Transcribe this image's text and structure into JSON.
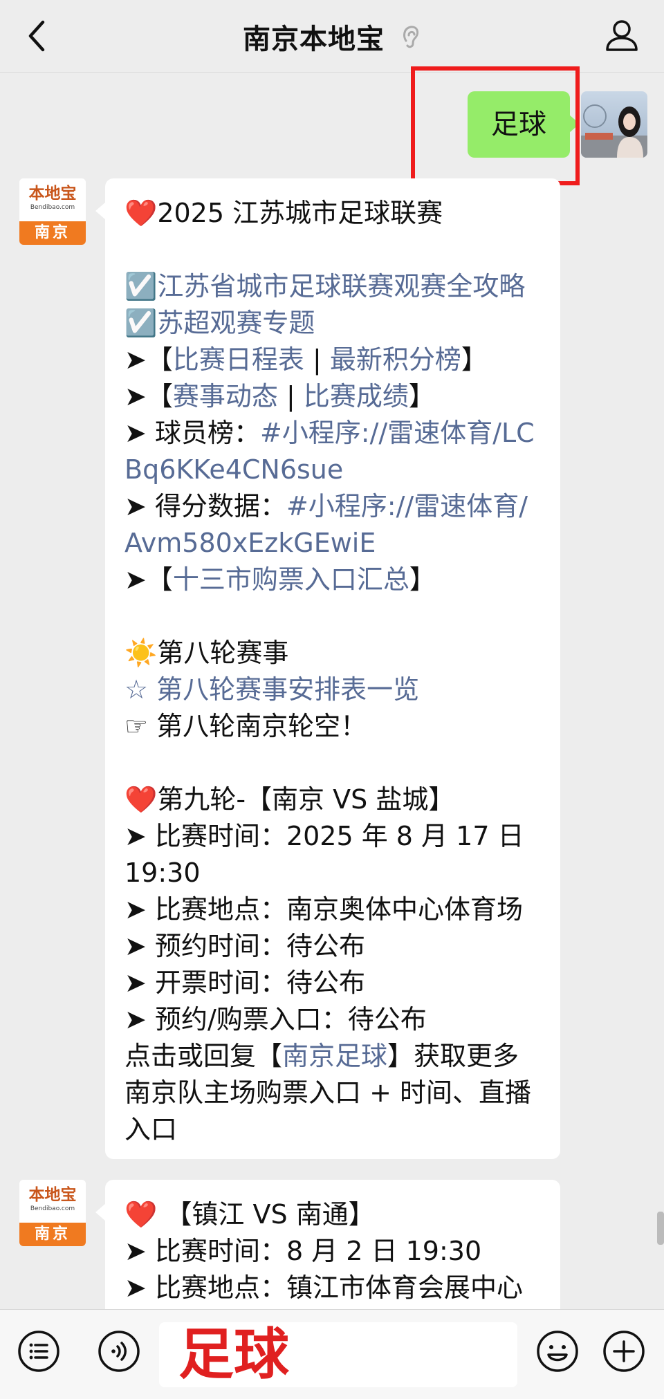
{
  "header": {
    "title": "南京本地宝"
  },
  "sent_message": {
    "text": "足球"
  },
  "bot": {
    "logo_name": "本地宝",
    "logo_domain": "Bendibao.com",
    "logo_city": "南京"
  },
  "message1": {
    "title": "2025 江苏城市足球联赛",
    "check_links": [
      "江苏省城市足球联赛观赛全攻略",
      "苏超观赛专题"
    ],
    "schedule_link": "比赛日程表",
    "standings_link": "最新积分榜",
    "news_link": "赛事动态",
    "results_link": "比赛成绩",
    "player_label": "球员榜：",
    "player_link": "#小程序://雷速体育/LCBq6KKe4CN6sue",
    "score_label": "得分数据：",
    "score_link": "#小程序://雷速体育/Avm580xEzkGEwiE",
    "ticket_link": "十三市购票入口汇总",
    "round8_title": "第八轮赛事",
    "round8_link": "第八轮赛事安排表一览",
    "round8_note": "第八轮南京轮空！",
    "round9_title": "第九轮-【南京 VS 盐城】",
    "round9_details": [
      "比赛时间：2025 年 8 月 17 日 19:30",
      "比赛地点：南京奥体中心体育场",
      "预约时间：待公布",
      "开票时间：待公布",
      "预约/购票入口：待公布"
    ],
    "footer_pre": "点击或回复【",
    "footer_link": "南京足球",
    "footer_post": "】获取更多南京队主场购票入口 + 时间、直播入口"
  },
  "message2": {
    "title": "【镇江 VS 南通】",
    "details": [
      "比赛时间：8 月 2 日 19:30",
      "比赛地点：镇江市体育会展中心"
    ]
  },
  "input": {
    "value": "足球"
  },
  "colors": {
    "link": "#576b95",
    "sent_bubble": "#95ec69",
    "highlight": "#ef1c1c",
    "input_text": "#e02020"
  }
}
